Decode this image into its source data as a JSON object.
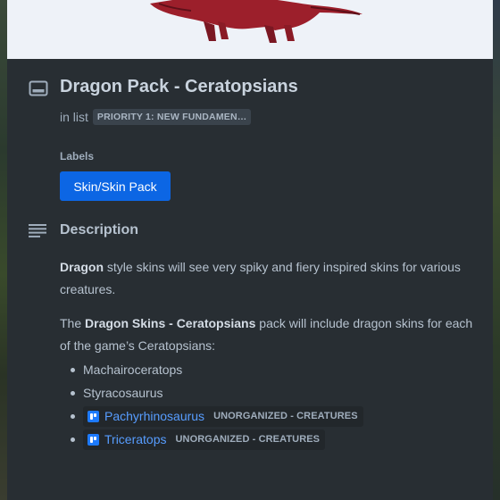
{
  "card": {
    "title": "Dragon Pack - Ceratopsians",
    "in_list_prefix": "in list",
    "list_name": "PRIORITY 1: NEW FUNDAMEN…",
    "labels_heading": "Labels",
    "labels": [
      "Skin/Skin Pack"
    ],
    "label_color": "#0c66e4",
    "description_heading": "Description",
    "description": {
      "p1_bold": "Dragon",
      "p1_rest": " style skins will see very spiky and fiery inspired skins for various creatures.",
      "p2_start": "The ",
      "p2_bold": "Dragon Skins - Ceratopsians",
      "p2_rest": " pack will include dragon skins for each of the game’s Ceratopsians:",
      "items": [
        {
          "text": "Machairoceratops"
        },
        {
          "text": "Styracosaurus"
        },
        {
          "link": "Pachyrhinosaurus",
          "tag": "UNORGANIZED - CREATURES"
        },
        {
          "link": "Triceratops",
          "tag": "UNORGANIZED - CREATURES"
        }
      ]
    }
  },
  "icons": {
    "card": "card-icon",
    "description": "description-icon",
    "trello_card_link": "trello-icon"
  },
  "colors": {
    "background": "#282e33",
    "link": "#579dff",
    "cover": "#eef2f8"
  }
}
